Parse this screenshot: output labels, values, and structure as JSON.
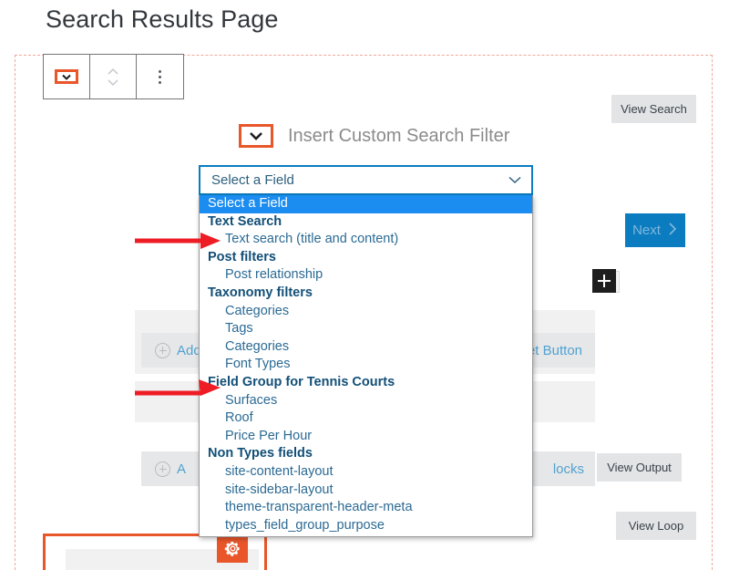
{
  "page": {
    "title": "Search Results Page"
  },
  "block_toolbar": {
    "block_type_icon": "chevron-down-icon",
    "move_icon": "move-up-down-icon",
    "options_icon": "vertical-dots-icon"
  },
  "insert_heading": {
    "icon": "chevron-down-icon",
    "label": "Insert Custom Search Filter"
  },
  "select_field": {
    "value": "Select a Field",
    "caret_icon": "chevron-down-icon",
    "options": [
      {
        "label": "Select a Field",
        "type": "option",
        "state": "selected"
      },
      {
        "label": "Text Search",
        "type": "group"
      },
      {
        "label": "Text search (title and content)",
        "type": "option"
      },
      {
        "label": "Post filters",
        "type": "group"
      },
      {
        "label": "Post relationship",
        "type": "option"
      },
      {
        "label": "Taxonomy filters",
        "type": "group"
      },
      {
        "label": "Categories",
        "type": "option"
      },
      {
        "label": "Tags",
        "type": "option"
      },
      {
        "label": "Categories",
        "type": "option"
      },
      {
        "label": "Font Types",
        "type": "option"
      },
      {
        "label": "Field Group for Tennis Courts",
        "type": "group"
      },
      {
        "label": "Surfaces",
        "type": "option"
      },
      {
        "label": "Roof",
        "type": "option"
      },
      {
        "label": "Price Per Hour",
        "type": "option"
      },
      {
        "label": "Non Types fields",
        "type": "group"
      },
      {
        "label": "site-content-layout",
        "type": "option"
      },
      {
        "label": "site-sidebar-layout",
        "type": "option"
      },
      {
        "label": "theme-transparent-header-meta",
        "type": "option"
      },
      {
        "label": "types_field_group_purpose",
        "type": "option"
      }
    ]
  },
  "canvas": {
    "add_button_label": "Add",
    "add_reset_button_label": "et Button",
    "add_blocks_label": "locks",
    "next_button_label": "Next",
    "next_button_icon": "chevron-right-icon",
    "add_block_icon": "plus-icon",
    "gear_icon": "gear-icon"
  },
  "theme_buttons": [
    {
      "label": "View Search",
      "name": "view-search-button"
    },
    {
      "label": "View Output",
      "name": "view-output-button"
    },
    {
      "label": "View Loop",
      "name": "view-loop-button"
    }
  ],
  "annotations": {
    "arrow_1_target": "Text search (title and content)",
    "arrow_2_target": "Field Group for Tennis Courts",
    "color": "#ee1c25"
  },
  "colors": {
    "accent_orange": "#e8562a",
    "select_border_blue": "#0b7cc0",
    "highlight_blue": "#1b8cf0",
    "option_blue": "#2b6a94",
    "group_blue": "#124f77",
    "dashed_outline": "#f0a79a"
  }
}
